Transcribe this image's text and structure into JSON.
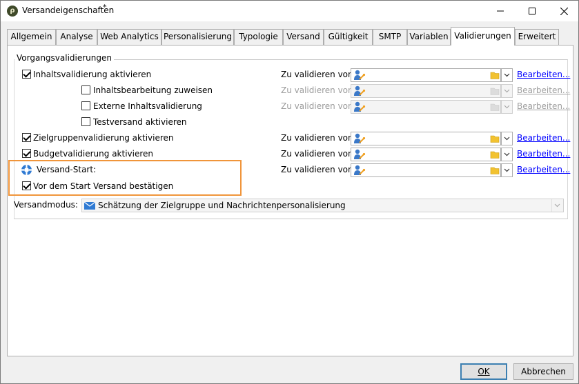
{
  "window": {
    "title": "Versandeigenschaften",
    "modified_marker": "*"
  },
  "tabs": [
    {
      "label": "Allgemein"
    },
    {
      "label": "Analyse"
    },
    {
      "label": "Web Analytics"
    },
    {
      "label": "Personalisierung"
    },
    {
      "label": "Typologie"
    },
    {
      "label": "Versand"
    },
    {
      "label": "Gültigkeit"
    },
    {
      "label": "SMTP"
    },
    {
      "label": "Variablen"
    },
    {
      "label": "Validierungen",
      "active": true
    },
    {
      "label": "Erweitert"
    }
  ],
  "group": {
    "legend": "Vorgangsvalidierungen"
  },
  "validations": [
    {
      "label": "Inhaltsvalidierung aktivieren",
      "checked": true,
      "enabled": true,
      "validate_label": "Zu validieren von:",
      "edit_label": "Bearbeiten..."
    },
    {
      "label": "Inhaltsbearbeitung zuweisen",
      "checked": false,
      "enabled": true,
      "validate_label": "Zu validieren von:",
      "edit_label": "Bearbeiten..."
    },
    {
      "label": "Externe Inhaltsvalidierung",
      "checked": false,
      "enabled": true,
      "validate_label": "Zu validieren von:",
      "edit_label": "Bearbeiten..."
    },
    {
      "label": "Testversand aktivieren",
      "checked": false,
      "enabled": true
    },
    {
      "label": "Zielgruppenvalidierung aktivieren",
      "checked": true,
      "enabled": true,
      "validate_label": "Zu validieren von:",
      "edit_label": "Bearbeiten..."
    },
    {
      "label": "Budgetvalidierung aktivieren",
      "checked": true,
      "enabled": true,
      "validate_label": "Zu validieren von:",
      "edit_label": "Bearbeiten..."
    }
  ],
  "start": {
    "label": "Versand-Start:",
    "validate_label": "Zu validieren von:",
    "edit_label": "Bearbeiten...",
    "confirm_label": "Vor dem Start Versand bestätigen",
    "confirm_checked": true
  },
  "mode": {
    "label": "Versandmodus:",
    "value": "Schätzung der Zielgruppe und Nachrichtenpersonalisierung"
  },
  "buttons": {
    "ok": "OK",
    "cancel": "Abbrechen"
  },
  "colors": {
    "highlight": "#f0953a",
    "link": "#0000ff"
  }
}
